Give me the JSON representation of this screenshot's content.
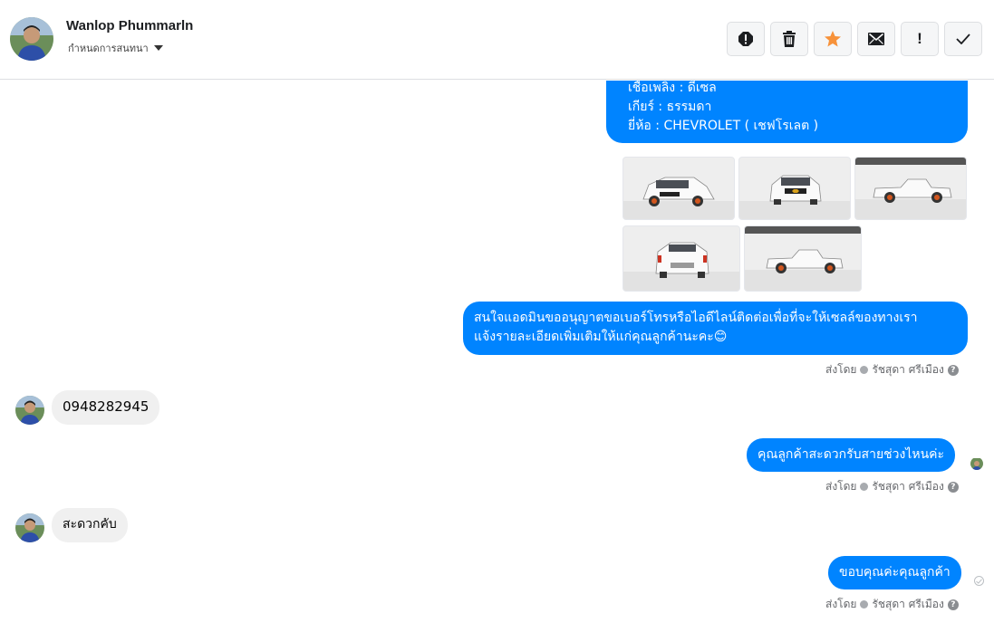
{
  "header": {
    "contact_name": "Wanlop Phummarln",
    "assign_label": "กำหนดการสนทนา",
    "actions": [
      {
        "icon": "alert-icon"
      },
      {
        "icon": "trash-icon"
      },
      {
        "icon": "star-icon"
      },
      {
        "icon": "mail-icon"
      },
      {
        "icon": "exclamation-icon",
        "label": "!"
      },
      {
        "icon": "check-icon"
      }
    ]
  },
  "thread": {
    "spec_lines": [
      "เชื้อเพลิง : ดีเซล",
      "เกียร์ : ธรรมดา",
      "ยี่ห้อ : CHEVROLET ( เชฟโรเลต )"
    ],
    "offer_message_line1": "สนใจแอดมินขออนุญาตขอเบอร์โทรหรือไอดีไลน์ติดต่อเพื่อที่จะให้เซลล์ของทางเรา",
    "offer_message_line2": "แจ้งรายละเอียดเพิ่มเติมให้แก่คุณลูกค้านะคะ😊",
    "sent_by_prefix": "ส่งโดย",
    "sender_name": "รัชสุดา ศรีเมือง",
    "help_glyph": "?",
    "customer_phone": "0948282945",
    "ask_time_message": "คุณลูกค้าสะดวกรับสายช่วงไหนค่ะ",
    "customer_reply": "สะดวกคับ",
    "thanks_message": "ขอบคุณค่ะคุณลูกค้า"
  },
  "colors": {
    "outgoing_bubble": "#0084ff",
    "incoming_bubble": "#f0f0f0",
    "star": "#f7923a"
  }
}
